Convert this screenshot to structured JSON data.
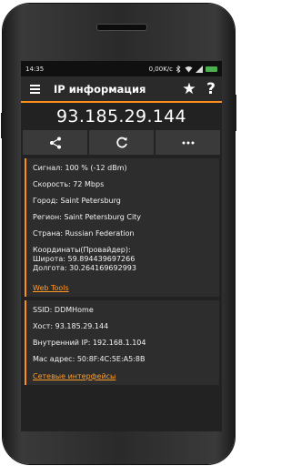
{
  "status": {
    "time": "14:35",
    "net_speed": "0,00K/c"
  },
  "appbar": {
    "title": "IP информация",
    "star_icon": "star-icon",
    "help_icon": "help-icon"
  },
  "ip": "93.185.29.144",
  "actions": [
    {
      "icon": "share-icon"
    },
    {
      "icon": "refresh-icon"
    },
    {
      "icon": "more-icon"
    }
  ],
  "info": {
    "signal": "Сигнал: 100 % (-12 dBm)",
    "speed": "Скорость: 72 Mbps",
    "city": "Город: Saint Petersburg",
    "region": "Регион: Saint Petersburg City",
    "country": "Страна: Russian Federation",
    "coords_label": "Координаты(Провайдер):",
    "latitude": "Широта: 59.894439697266",
    "longitude": "Долгота: 30.264169692993",
    "link": "Web Tools"
  },
  "local": {
    "ssid": "SSID: DDMHome",
    "host": "Хост: 93.185.29.144",
    "internal_ip": "Внутренний IP: 192.168.1.104",
    "mac": "Mac адрес: 50:8F:4C:5E:A5:8B",
    "link": "Сетевые интерфейсы"
  },
  "colors": {
    "accent": "#ff8f1a",
    "background": "#222222",
    "card": "#2d2d2d"
  }
}
